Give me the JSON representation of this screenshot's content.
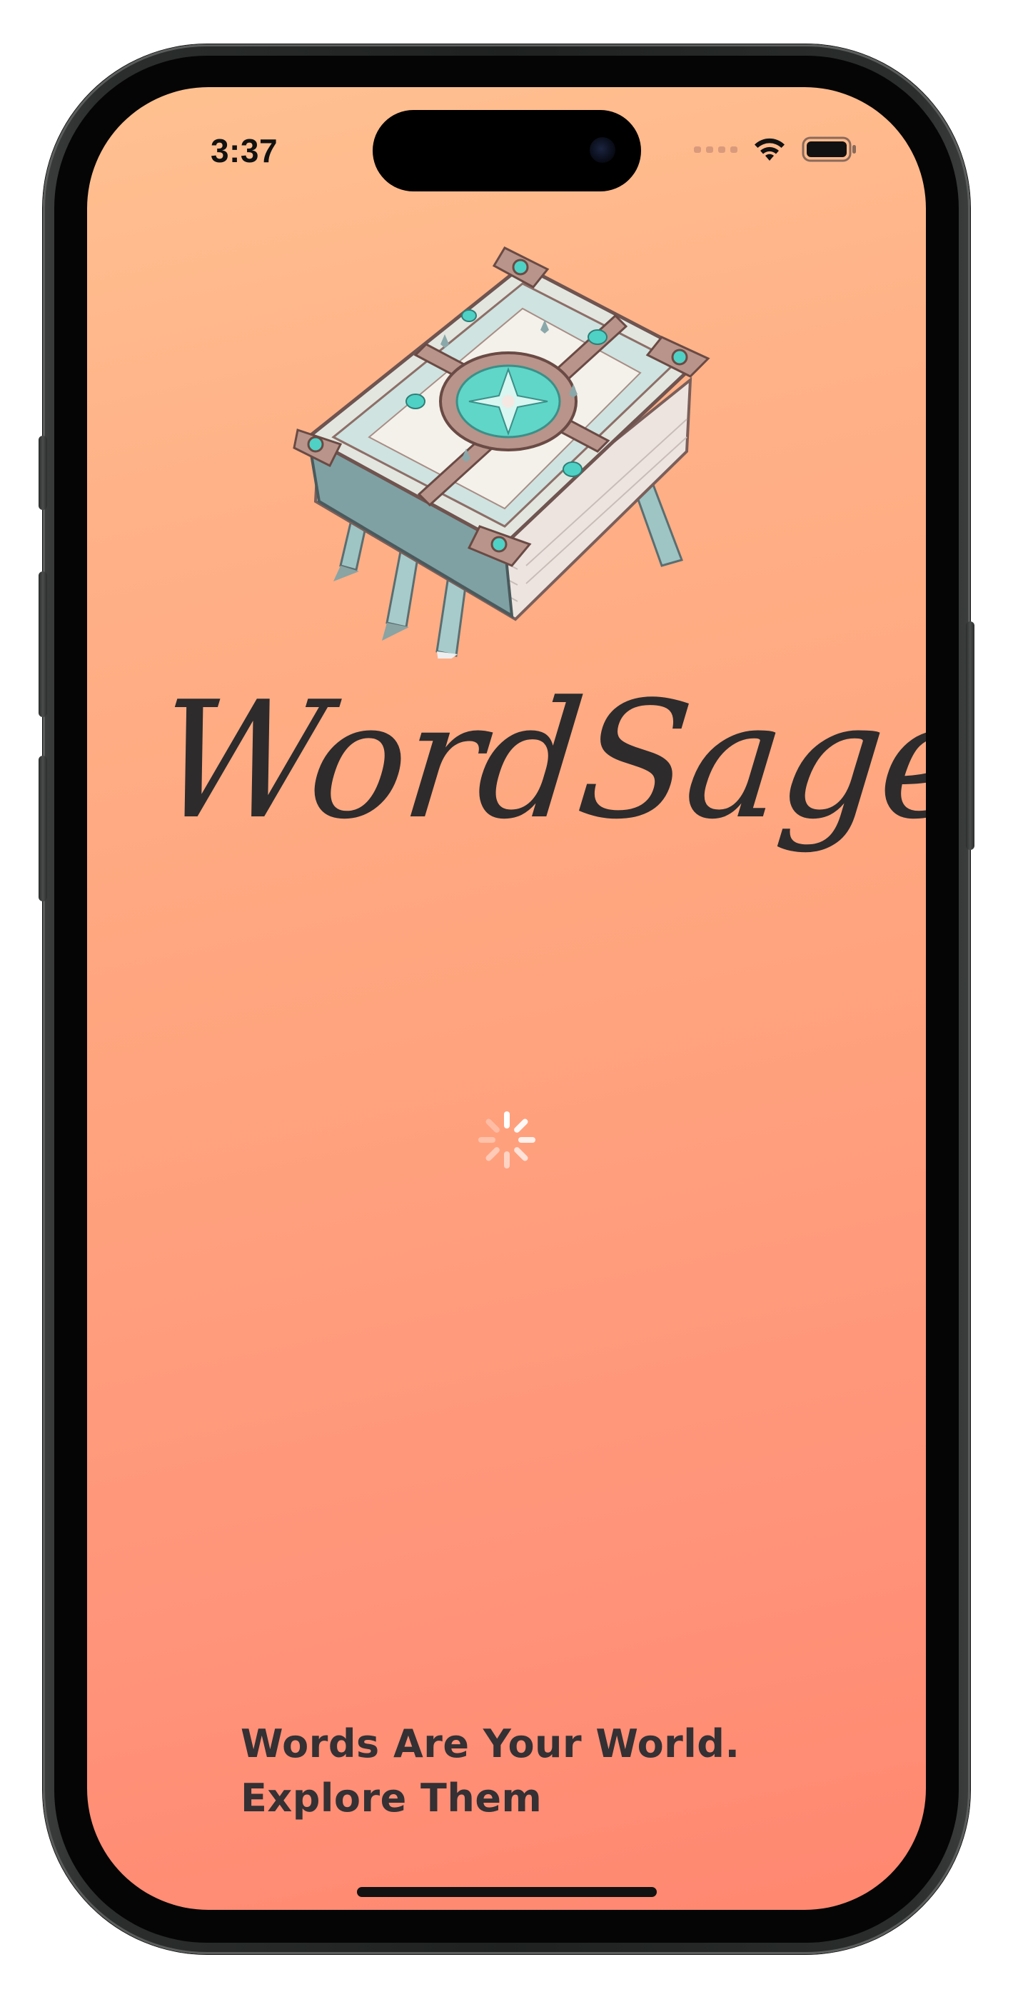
{
  "status_bar": {
    "time": "3:37"
  },
  "app": {
    "title": "WordSage",
    "tagline_line1": "Words Are Your World.",
    "tagline_line2": "Explore Them"
  },
  "icons": {
    "logo": "ornate-book-icon",
    "loading": "loading-spinner-icon",
    "wifi": "wifi-icon",
    "battery": "battery-icon",
    "signal": "cellular-signal-icon"
  },
  "colors": {
    "background_top": "#ffc191",
    "background_bottom": "#ff8770",
    "text": "#2d2b2c",
    "book_accent": "#4fd1c5"
  }
}
